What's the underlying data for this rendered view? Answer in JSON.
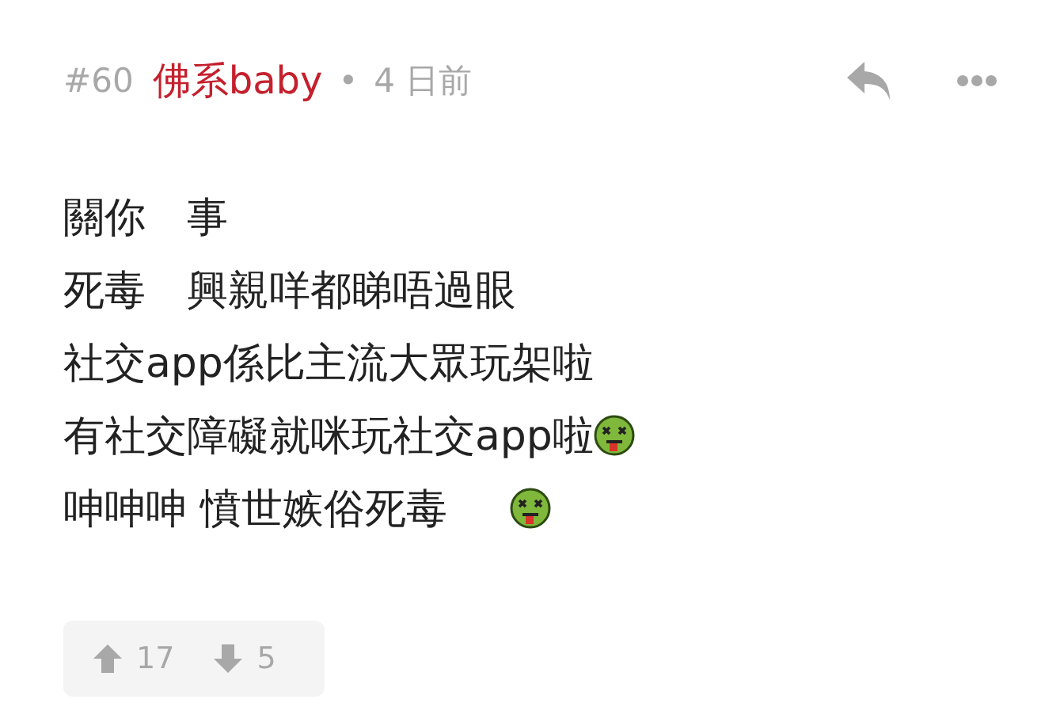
{
  "post": {
    "number": "#60",
    "author": "佛系baby",
    "separator": "•",
    "time": "4 日前"
  },
  "lines": [
    {
      "kind": "plain",
      "text": "關你　事"
    },
    {
      "kind": "plain",
      "text": "死毒　興親咩都睇唔過眼"
    },
    {
      "kind": "plain",
      "text": "社交app係比主流大眾玩架啦"
    },
    {
      "kind": "emoji",
      "text": "有社交障礙就咪玩社交app啦"
    },
    {
      "kind": "gapemoji",
      "text": "呻呻呻 憤世嫉俗死毒"
    }
  ],
  "votes": {
    "up": "17",
    "down": "5"
  }
}
